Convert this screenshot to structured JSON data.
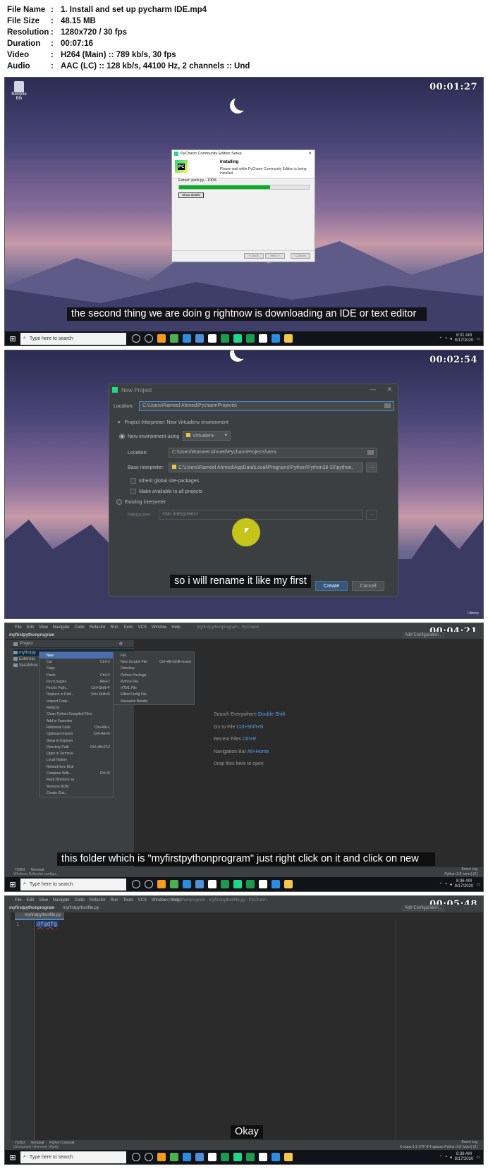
{
  "meta": [
    {
      "k": "File Name",
      "v": "1. Install and set up pycharm IDE.mp4"
    },
    {
      "k": "File Size",
      "v": "48.15 MB"
    },
    {
      "k": "Resolution",
      "v": "1280x720 / 30 fps"
    },
    {
      "k": "Duration",
      "v": "00:07:16"
    },
    {
      "k": "Video",
      "v": "H264 (Main) :: 789 kb/s, 30 fps"
    },
    {
      "k": "Audio",
      "v": "AAC (LC) :: 128 kb/s, 44100 Hz, 2 channels :: Und"
    }
  ],
  "colon": ":",
  "taskbar": {
    "search": "Type here to search",
    "time1": "8:01 AM",
    "time2": "8:36 AM",
    "time3": "8:38 AM",
    "date": "8/17/2020"
  },
  "frame1": {
    "ts": "00:01:27",
    "recycle": "Recycle Bin",
    "dlg_title": "PyCharm Community Edition Setup",
    "heading": "Installing",
    "desc": "Please wait while PyCharm Community Edition is being installed.",
    "extract": "Extract: parts.py... 100%",
    "progress": 0.7,
    "details_btn": "Show details",
    "back": "< Back",
    "next": "Next >",
    "cancel": "Cancel",
    "subtitle": "the second thing we are doin g rightnow is downloading an IDE or text editor"
  },
  "frame2": {
    "ts": "00:02:54",
    "title": "New Project",
    "location_label": "Location:",
    "location": "C:\\Users\\Rameel Ahmed\\PycharmProjects\\",
    "interp_section": "Project Interpreter: New Virtualenv environment",
    "new_env": "New environment using",
    "venv": "Virtualenv",
    "loc2_label": "Location:",
    "loc2": "C:\\Users\\Rameel Ahmed\\PycharmProjects\\venv",
    "base_label": "Base interpreter:",
    "base": "C:\\Users\\Rameel Ahmed\\AppData\\Local\\Programs\\Python\\Python38-32\\python.",
    "inherit": "Inherit global site-packages",
    "avail": "Make available to all projects",
    "existing": "Existing interpreter",
    "interp_label": "Interpreter:",
    "no_interp": "<No interpreter>",
    "create": "Create",
    "cancel": "Cancel",
    "subtitle": "so i will rename it like my first",
    "brand": "Udemy"
  },
  "frame3": {
    "ts": "00:04:21",
    "menus": [
      "File",
      "Edit",
      "View",
      "Navigate",
      "Code",
      "Refactor",
      "Run",
      "Tools",
      "VCS",
      "Window",
      "Help"
    ],
    "window_title": "myfirstpythonprogram - PyCharm",
    "project": "myfirstpythonprogram",
    "panel": "Project",
    "add_config": "Add Configuration...",
    "tree": [
      "myfirstpy",
      "External",
      "Scratches"
    ],
    "ctx": [
      {
        "l": "New",
        "s": ""
      },
      {
        "l": "Cut",
        "s": "Ctrl+X"
      },
      {
        "l": "Copy",
        "s": ""
      },
      {
        "l": "Paste",
        "s": "Ctrl+V"
      },
      {
        "l": "Find Usages",
        "s": "Alt+F7"
      },
      {
        "l": "Find in Path...",
        "s": "Ctrl+Shift+F"
      },
      {
        "l": "Replace in Path...",
        "s": "Ctrl+Shift+R"
      },
      {
        "l": "Inspect Code...",
        "s": ""
      },
      {
        "l": "Refactor",
        "s": ""
      },
      {
        "l": "Clean Python Compiled Files",
        "s": ""
      },
      {
        "l": "Add to Favorites",
        "s": ""
      },
      {
        "l": "Reformat Code",
        "s": "Ctrl+Alt+L"
      },
      {
        "l": "Optimize Imports",
        "s": "Ctrl+Alt+O"
      },
      {
        "l": "Show in Explorer",
        "s": ""
      },
      {
        "l": "Directory Path",
        "s": "Ctrl+Alt+F12"
      },
      {
        "l": "Open in Terminal",
        "s": ""
      },
      {
        "l": "Local History",
        "s": ""
      },
      {
        "l": "Reload from Disk",
        "s": ""
      },
      {
        "l": "Compare With...",
        "s": "Ctrl+D"
      },
      {
        "l": "Mark Directory as",
        "s": ""
      },
      {
        "l": "Remove BOM",
        "s": ""
      },
      {
        "l": "Create Gist...",
        "s": ""
      }
    ],
    "sub": [
      {
        "l": "File",
        "s": ""
      },
      {
        "l": "New Scratch File",
        "s": "Ctrl+Alt+Shift+Insert"
      },
      {
        "l": "Directory",
        "s": ""
      },
      {
        "l": "Python Package",
        "s": ""
      },
      {
        "l": "Python File",
        "s": ""
      },
      {
        "l": "HTML File",
        "s": ""
      },
      {
        "l": "EditorConfig File",
        "s": ""
      },
      {
        "l": "Resource Bundle",
        "s": ""
      }
    ],
    "welcome": [
      {
        "l": "Search Everywhere",
        "k": "Double Shift"
      },
      {
        "l": "Go to File",
        "k": "Ctrl+Shift+N"
      },
      {
        "l": "Recent Files",
        "k": "Ctrl+E"
      },
      {
        "l": "Navigation Bar",
        "k": "Alt+Home"
      },
      {
        "l": "Drop files here to open",
        "k": ""
      }
    ],
    "bottom_tabs": [
      "TODO",
      "Terminal"
    ],
    "status": "Windows Defender configu...",
    "event": "Event Log",
    "python": "Python 3.8 (venv) (2)",
    "subtitle": "this folder which is \"myfirstpythonprogram\" just right click on it and click on new"
  },
  "frame4": {
    "ts": "00:05:48",
    "menus": [
      "File",
      "Edit",
      "View",
      "Navigate",
      "Code",
      "Refactor",
      "Run",
      "Tools",
      "VCS",
      "Window",
      "Help"
    ],
    "window_title": "myfirstpythonprogram - myfirstpythonfile.py - PyCharm",
    "crumb1": "myfirstpythonprogram",
    "crumb2": "myfirstpythonfile.py",
    "tab": "myfirstpythonfile.py",
    "add_config": "Add Configuration...",
    "line": "1",
    "code": "dfgdfg",
    "bottom_tabs": [
      "TODO",
      "Terminal",
      "Python Console"
    ],
    "status": "Unresolved reference 'dfgdfg'",
    "statusr": "6 chars  1:1  UTF-8  4 spaces  Python 3.8 (venv) (2)",
    "event": "Event Log",
    "subtitle": "Okay"
  }
}
